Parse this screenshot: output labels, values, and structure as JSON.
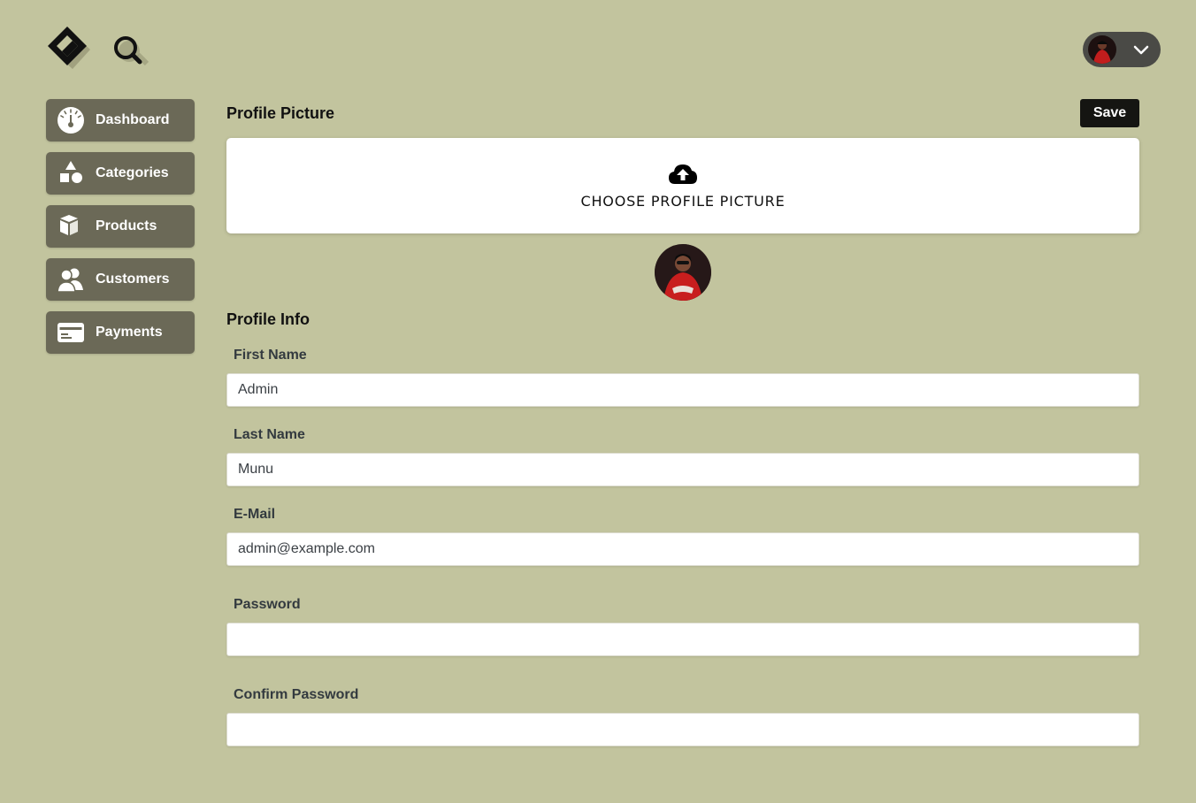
{
  "colors": {
    "background": "#c2c49e",
    "sidebar_item": "#6b6957",
    "save_button": "#151512",
    "user_menu": "#4a4a46"
  },
  "header": {
    "logo_icon": "diamond-logo-icon",
    "search_icon": "search-icon",
    "user_menu_icon": "chevron-down-icon"
  },
  "sidebar": {
    "items": [
      {
        "label": "Dashboard",
        "icon": "gauge-icon"
      },
      {
        "label": "Categories",
        "icon": "shapes-icon"
      },
      {
        "label": "Products",
        "icon": "box-icon"
      },
      {
        "label": "Customers",
        "icon": "users-icon"
      },
      {
        "label": "Payments",
        "icon": "credit-card-icon"
      }
    ]
  },
  "profile_picture": {
    "title": "Profile Picture",
    "save_label": "Save",
    "upload_label": "CHOOSE PROFILE PICTURE",
    "upload_icon": "cloud-upload-icon"
  },
  "profile_info": {
    "title": "Profile Info",
    "first_name": {
      "label": "First Name",
      "value": "Admin"
    },
    "last_name": {
      "label": "Last Name",
      "value": "Munu"
    },
    "email": {
      "label": "E-Mail",
      "value": "admin@example.com"
    },
    "password": {
      "label": "Password",
      "value": ""
    },
    "confirm_password": {
      "label": "Confirm Password",
      "value": ""
    }
  }
}
